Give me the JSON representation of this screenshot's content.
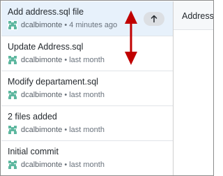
{
  "history": {
    "commits": [
      {
        "title": "Add address.sql file",
        "author": "dcalbimonte",
        "separator": "•",
        "time": "4 minutes ago",
        "selected": true,
        "push_icon": "arrow-up-icon"
      },
      {
        "title": "Update Address.sql",
        "author": "dcalbimonte",
        "separator": "•",
        "time": "last month"
      },
      {
        "title": "Modify departament.sql",
        "author": "dcalbimonte",
        "separator": "•",
        "time": "last month"
      },
      {
        "title": "2 files added",
        "author": "dcalbimonte",
        "separator": "•",
        "time": "last month"
      },
      {
        "title": "Initial commit",
        "author": "dcalbimonte",
        "separator": "•",
        "time": "last month"
      }
    ]
  },
  "detail": {
    "file_tab": "Address.s"
  },
  "colors": {
    "selected_row": "#e7f1fb",
    "avatar": "#5fb8a0",
    "annotation_arrow": "#c00000"
  },
  "icons": {
    "avatar": "identicon-avatar-icon",
    "push": "arrow-up-icon",
    "annotation": "double-headed-arrow-icon"
  }
}
